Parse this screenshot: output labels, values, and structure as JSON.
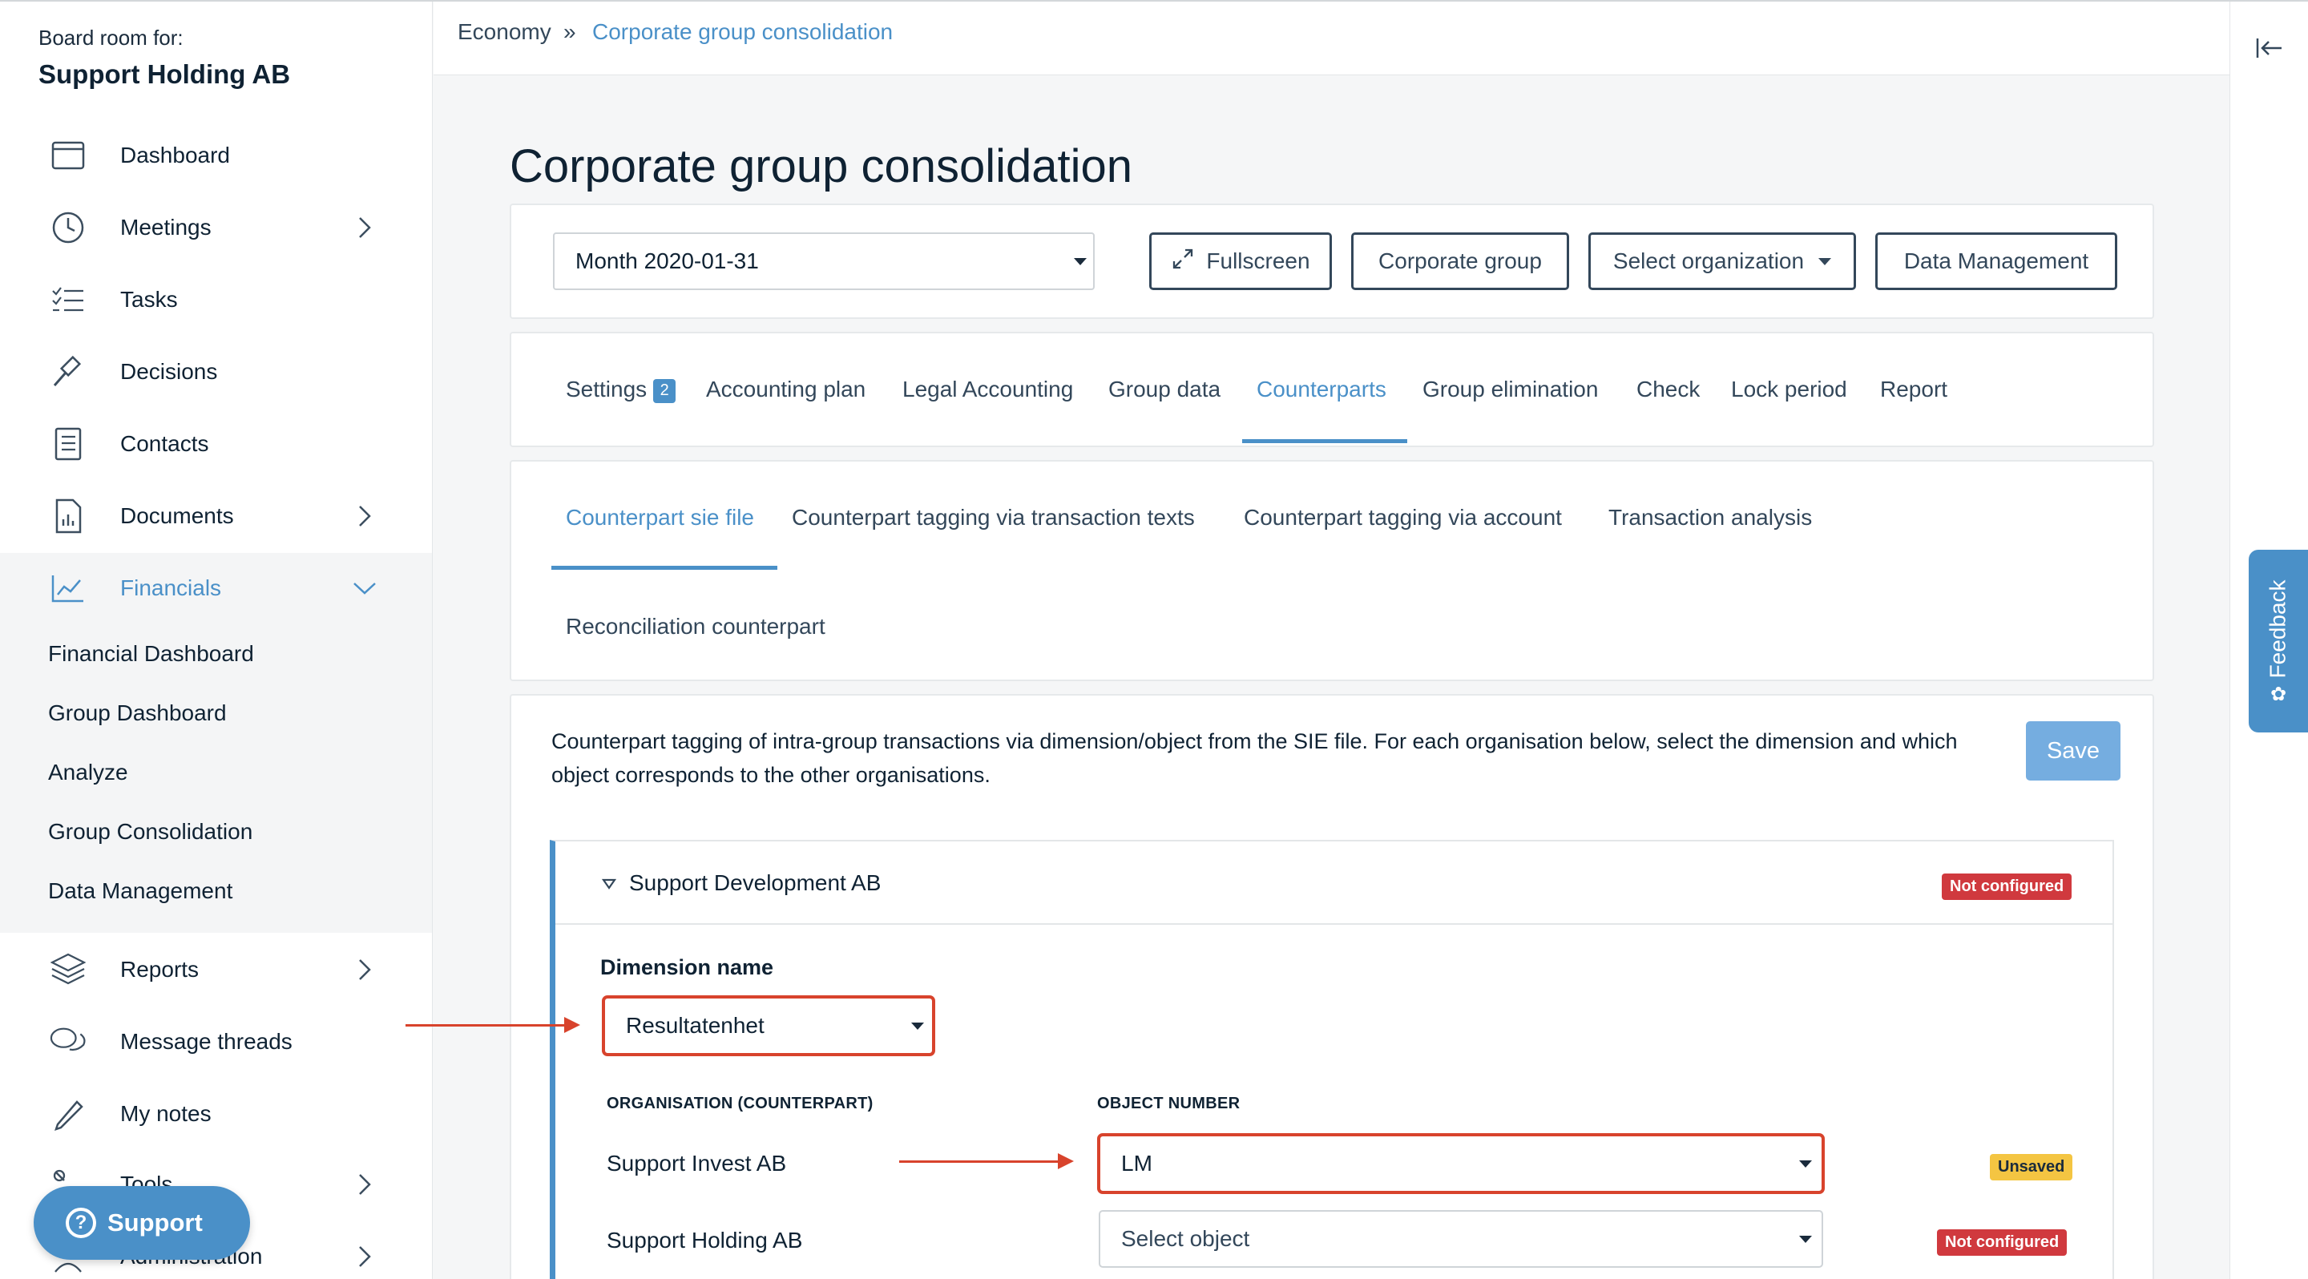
{
  "sidebar": {
    "board_for": "Board room for:",
    "board_name": "Support Holding AB",
    "items": [
      {
        "label": "Dashboard"
      },
      {
        "label": "Meetings"
      },
      {
        "label": "Tasks"
      },
      {
        "label": "Decisions"
      },
      {
        "label": "Contacts"
      },
      {
        "label": "Documents"
      },
      {
        "label": "Financials"
      },
      {
        "label": "Reports"
      },
      {
        "label": "Message threads"
      },
      {
        "label": "My notes"
      },
      {
        "label": "Tools"
      },
      {
        "label": "Administration"
      }
    ],
    "financials_sub": [
      "Financial Dashboard",
      "Group Dashboard",
      "Analyze",
      "Group Consolidation",
      "Data Management"
    ],
    "support_label": "Support"
  },
  "breadcrumb": {
    "root": "Economy",
    "separator": "»",
    "current": "Corporate group consolidation"
  },
  "page_title": "Corporate group consolidation",
  "toolbar": {
    "month_value": "Month 2020-01-31",
    "fullscreen": "Fullscreen",
    "corporate_group": "Corporate group",
    "select_org": "Select organization",
    "data_management": "Data Management"
  },
  "tabs": {
    "items": [
      "Settings",
      "Accounting plan",
      "Legal Accounting",
      "Group data",
      "Counterparts",
      "Group elimination",
      "Check",
      "Lock period",
      "Report"
    ],
    "settings_badge": "2",
    "active": "Counterparts"
  },
  "subtabs": {
    "items": [
      "Counterpart sie file",
      "Counterpart tagging via transaction texts",
      "Counterpart tagging via account",
      "Transaction analysis",
      "Reconciliation counterpart"
    ],
    "active": "Counterpart sie file"
  },
  "content": {
    "description": "Counterpart tagging of intra-group transactions via dimension/object from the SIE file. For each organisation below, select the dimension and which object corresponds to the other organisations.",
    "save": "Save",
    "org": {
      "name": "Support Development AB",
      "status": "Not configured",
      "dimension_label": "Dimension name",
      "dimension_value": "Resultatenhet",
      "col_org": "ORGANISATION (COUNTERPART)",
      "col_obj": "OBJECT NUMBER",
      "rows": [
        {
          "org": "Support Invest AB",
          "object": "LM",
          "status": "Unsaved"
        },
        {
          "org": "Support Holding AB",
          "object": "Select object",
          "status": "Not configured"
        }
      ]
    }
  },
  "feedback": "Feedback",
  "colors": {
    "accent": "#4a90c8",
    "danger": "#d0393e",
    "warning": "#f4c542",
    "annotation": "#d8432c"
  }
}
